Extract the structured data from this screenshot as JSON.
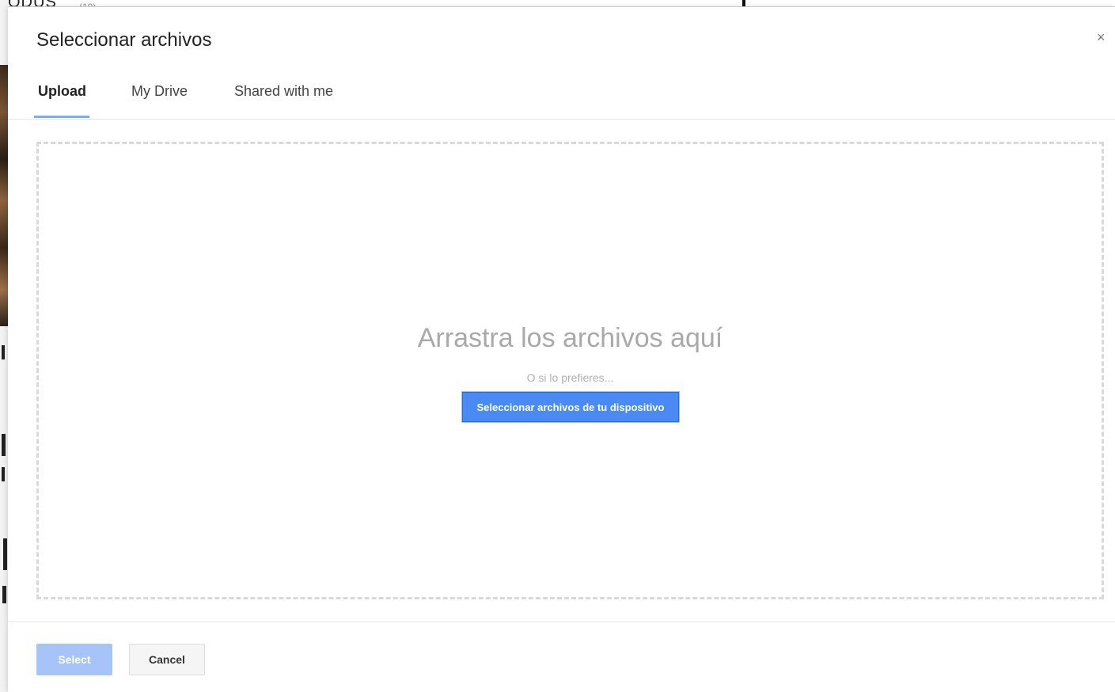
{
  "background": {
    "top_text": "ODUS",
    "top_small": "(10)"
  },
  "dialog": {
    "title": "Seleccionar archivos",
    "close_glyph": "×",
    "tabs": [
      {
        "label": "Upload",
        "active": true
      },
      {
        "label": "My Drive",
        "active": false
      },
      {
        "label": "Shared with me",
        "active": false
      }
    ],
    "dropzone": {
      "title": "Arrastra los archivos aquí",
      "subtitle": "O si lo prefieres...",
      "button_label": "Seleccionar archivos de tu dispositivo"
    },
    "footer": {
      "select_label": "Select",
      "cancel_label": "Cancel"
    }
  },
  "colors": {
    "accent": "#4a8af4",
    "accent_disabled": "#a6c4f8",
    "dashed_border": "#d9d9d9"
  },
  "icons": {
    "close": "close-icon"
  }
}
